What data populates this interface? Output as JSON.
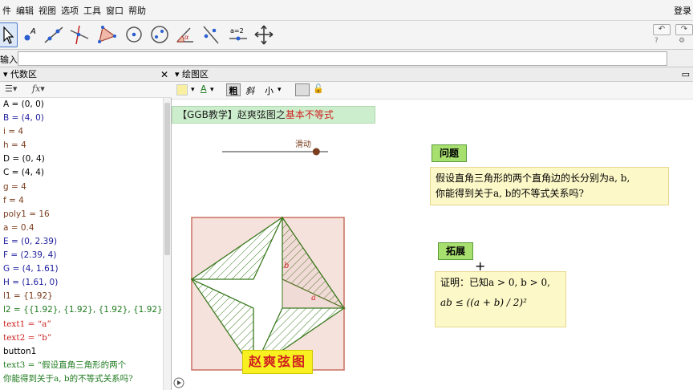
{
  "menubar": {
    "items": [
      "件",
      "编辑",
      "视图",
      "选项",
      "工具",
      "窗口",
      "帮助"
    ],
    "login": "登录"
  },
  "input_bar": {
    "label": "输入:",
    "value": ""
  },
  "algebra": {
    "title": "代数区",
    "close": "✕",
    "rows": [
      {
        "text": "A = (0, 0)",
        "color": "black"
      },
      {
        "text": "B = (4, 0)",
        "color": "blue"
      },
      {
        "text": "i = 4",
        "color": "brown"
      },
      {
        "text": "h = 4",
        "color": "brown"
      },
      {
        "text": "D = (0, 4)",
        "color": "black"
      },
      {
        "text": "C = (4, 4)",
        "color": "black"
      },
      {
        "text": "g = 4",
        "color": "brown"
      },
      {
        "text": "f = 4",
        "color": "brown"
      },
      {
        "text": "poly1 = 16",
        "color": "brown"
      },
      {
        "text": "a = 0.4",
        "color": "brown"
      },
      {
        "text": "E = (0, 2.39)",
        "color": "blue"
      },
      {
        "text": "F = (2.39, 4)",
        "color": "blue"
      },
      {
        "text": "G = (4, 1.61)",
        "color": "blue"
      },
      {
        "text": "H = (1.61, 0)",
        "color": "blue"
      },
      {
        "text": "l1 = {1.92}",
        "color": "brown"
      },
      {
        "text": "l2 = {{1.92}, {1.92}, {1.92}, {1.92}}",
        "color": "green"
      },
      {
        "text": "text1 = “a”",
        "color": "red",
        "serif": true
      },
      {
        "text": "text2 = “b”",
        "color": "red",
        "serif": true
      },
      {
        "text": "button1",
        "color": "black"
      },
      {
        "text": "text3 = “假设直角三角形的两个",
        "color": "green",
        "serif": true
      },
      {
        "text": "你能得到关于a, b的不等式关系吗?",
        "color": "green",
        "serif": true
      }
    ]
  },
  "graphics": {
    "title": "绘图区",
    "style_bar": {
      "bold": "粗",
      "italic": "斜",
      "size": "小"
    },
    "heading_prefix": "【GGB教学】赵爽弦图之",
    "heading_red": "基本不等式",
    "slider_label": "滑动",
    "slider_value": 0.4,
    "side_label_a": "a",
    "side_label_b": "b",
    "problem_label": "问题",
    "problem_line1": "假设直角三角形的两个直角边的长分别为a, b,",
    "problem_line2": "你能得到关于a, b的不等式关系吗?",
    "extension_label": "拓展",
    "proof_line1": "证明：已知a > 0, b > 0,",
    "proof_line2": "ab ≤ ((a + b) / 2)²",
    "figure_title": "赵爽弦图"
  },
  "colors": {
    "square_fill": "#f6e2dc",
    "square_stroke": "#c87060",
    "triangle_stroke": "#3a7a1e",
    "label_green": "#a8e070",
    "yellow_bg": "#fdf8c8"
  }
}
